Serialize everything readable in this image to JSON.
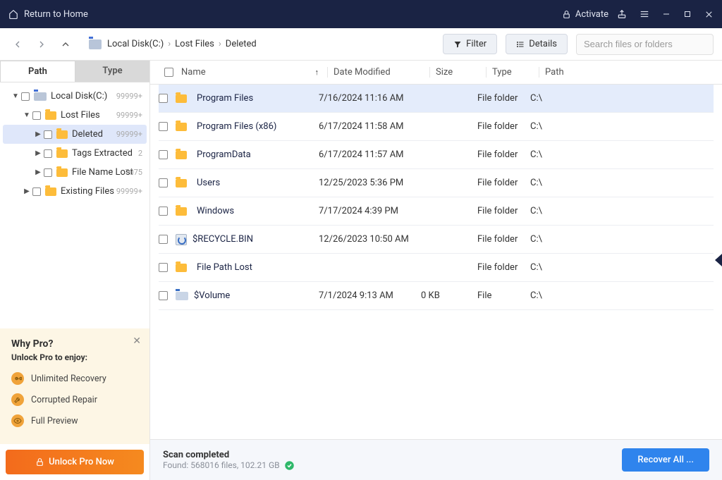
{
  "titlebar": {
    "home_label": "Return to Home",
    "activate_label": "Activate"
  },
  "toolbar": {
    "breadcrumb": [
      "Local Disk(C:)",
      "Lost Files",
      "Deleted"
    ],
    "filter_label": "Filter",
    "details_label": "Details",
    "search_placeholder": "Search files or folders"
  },
  "sidebar": {
    "tabs": {
      "path": "Path",
      "type": "Type"
    },
    "tree": {
      "local_disk": {
        "label": "Local Disk(C:)",
        "count": "99999+"
      },
      "lost_files": {
        "label": "Lost Files",
        "count": "99999+"
      },
      "deleted": {
        "label": "Deleted",
        "count": "99999+"
      },
      "tags": {
        "label": "Tags Extracted",
        "count": "2"
      },
      "filename_lost": {
        "label": "File Name Lost",
        "count": "7075"
      },
      "existing": {
        "label": "Existing Files",
        "count": "99999+"
      }
    }
  },
  "table": {
    "headers": {
      "name": "Name",
      "date": "Date Modified",
      "size": "Size",
      "type": "Type",
      "path": "Path"
    },
    "rows": [
      {
        "name": "Program Files",
        "date": "7/16/2024 11:16 AM",
        "size": "",
        "type": "File folder",
        "path": "C:\\",
        "icon": "folder",
        "selected": true
      },
      {
        "name": "Program Files (x86)",
        "date": "6/17/2024 11:58 AM",
        "size": "",
        "type": "File folder",
        "path": "C:\\",
        "icon": "folder"
      },
      {
        "name": "ProgramData",
        "date": "6/17/2024 11:57 AM",
        "size": "",
        "type": "File folder",
        "path": "C:\\",
        "icon": "folder"
      },
      {
        "name": "Users",
        "date": "12/25/2023 5:36 PM",
        "size": "",
        "type": "File folder",
        "path": "C:\\",
        "icon": "folder"
      },
      {
        "name": "Windows",
        "date": "7/17/2024 4:39 PM",
        "size": "",
        "type": "File folder",
        "path": "C:\\",
        "icon": "folder"
      },
      {
        "name": "$RECYCLE.BIN",
        "date": "12/26/2023 10:50 AM",
        "size": "",
        "type": "File folder",
        "path": "C:\\",
        "icon": "recycle"
      },
      {
        "name": "File Path Lost",
        "date": "",
        "size": "",
        "type": "File folder",
        "path": "C:\\",
        "icon": "folder"
      },
      {
        "name": "$Volume",
        "date": "7/1/2024 9:13 AM",
        "size": "0 KB",
        "type": "File",
        "path": "C:\\",
        "icon": "volume"
      }
    ]
  },
  "promo": {
    "title": "Why Pro?",
    "subtitle": "Unlock Pro to enjoy:",
    "features": [
      "Unlimited Recovery",
      "Corrupted Repair",
      "Full Preview"
    ],
    "unlock_label": "Unlock Pro Now"
  },
  "footer": {
    "title": "Scan completed",
    "subtitle": "Found: 568016 files, 102.21 GB",
    "recover_label": "Recover All ..."
  }
}
